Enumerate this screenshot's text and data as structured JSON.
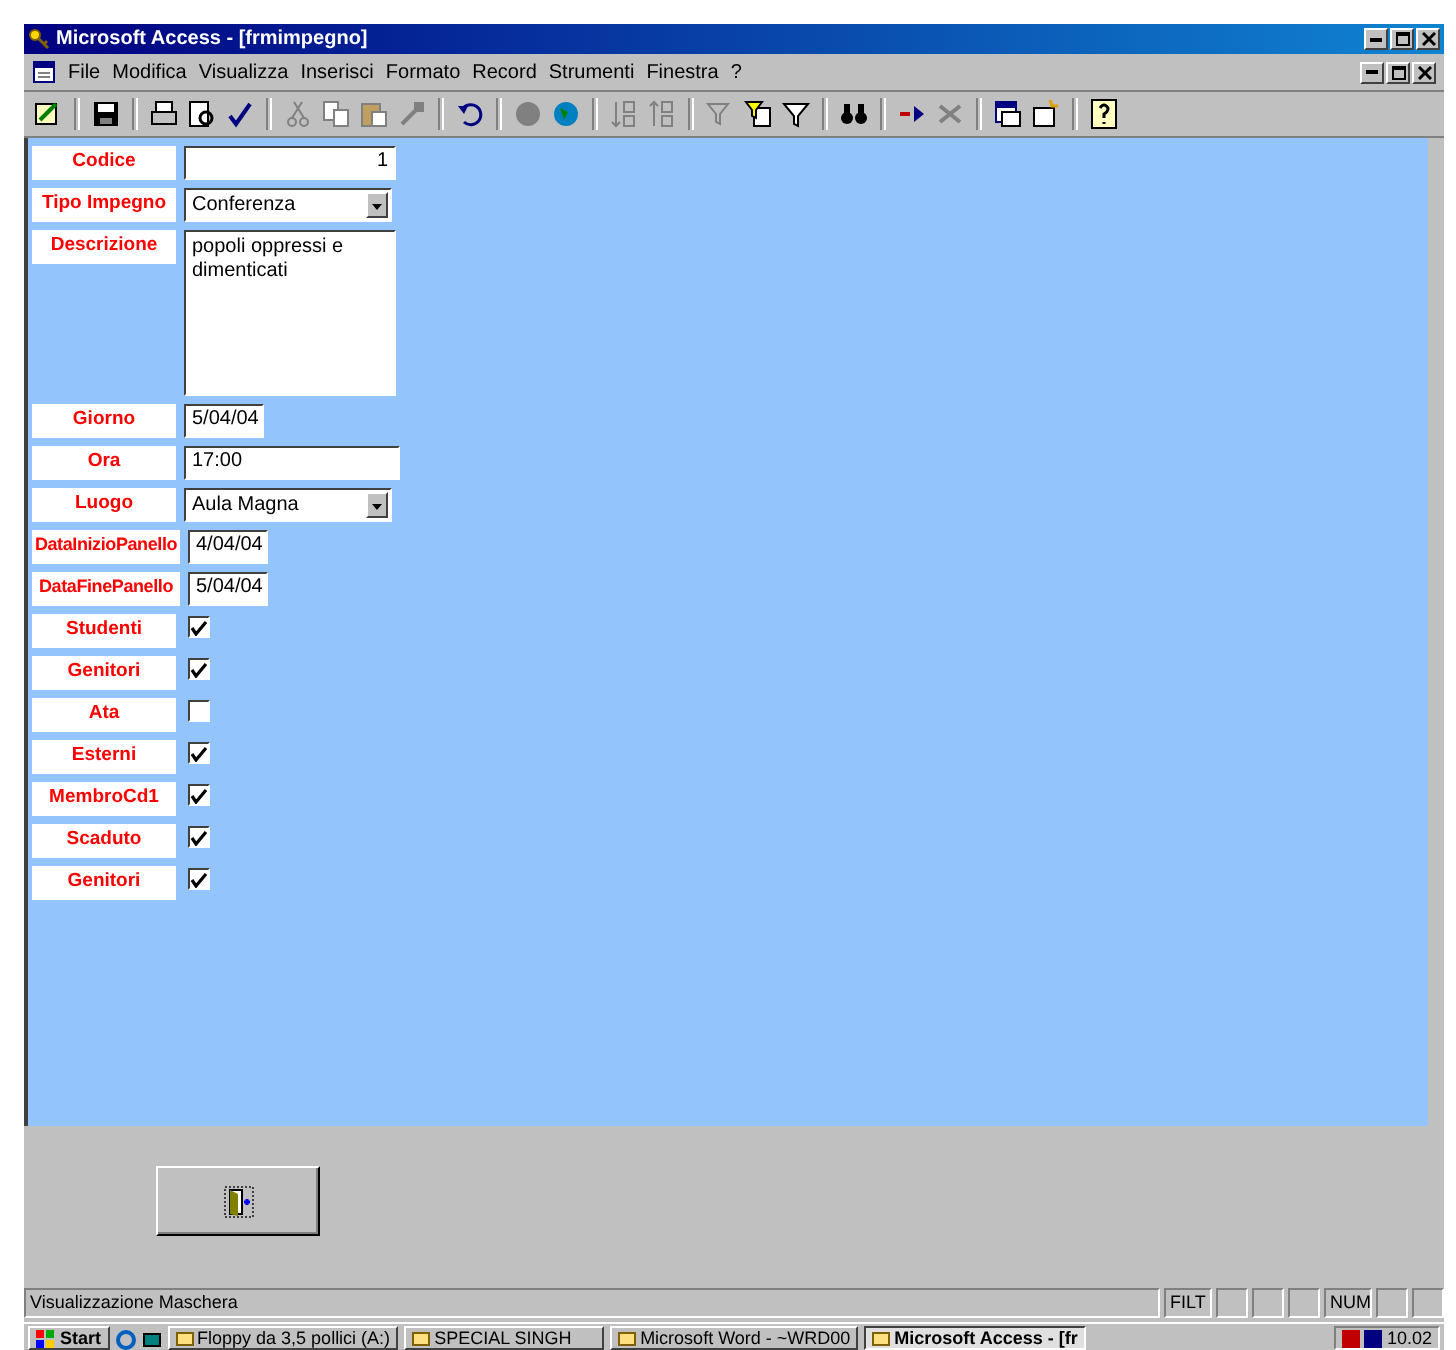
{
  "window": {
    "title": "Microsoft Access - [frmimpegno]"
  },
  "menu": [
    "File",
    "Modifica",
    "Visualizza",
    "Inserisci",
    "Formato",
    "Record",
    "Strumenti",
    "Finestra",
    "?"
  ],
  "form": {
    "fields": [
      {
        "label": "Codice",
        "kind": "number",
        "value": "1"
      },
      {
        "label": "Tipo Impegno",
        "kind": "combo",
        "value": "Conferenza"
      },
      {
        "label": "Descrizione",
        "kind": "memo",
        "value": "popoli oppressi e dimenticati"
      },
      {
        "label": "Giorno",
        "kind": "date",
        "value": "5/04/04"
      },
      {
        "label": "Ora",
        "kind": "text",
        "value": "17:00"
      },
      {
        "label": "Luogo",
        "kind": "combo",
        "value": "Aula Magna"
      },
      {
        "label": "DataInizioPanello",
        "kind": "date",
        "value": "4/04/04"
      },
      {
        "label": "DataFinePanello",
        "kind": "date",
        "value": "5/04/04"
      },
      {
        "label": "Studenti",
        "kind": "check",
        "checked": true
      },
      {
        "label": "Genitori",
        "kind": "check",
        "checked": true
      },
      {
        "label": "Ata",
        "kind": "check",
        "checked": false
      },
      {
        "label": "Esterni",
        "kind": "check",
        "checked": true
      },
      {
        "label": "MembroCd1",
        "kind": "check",
        "checked": true
      },
      {
        "label": "Scaduto",
        "kind": "check",
        "checked": true
      },
      {
        "label": "Genitori",
        "kind": "check",
        "checked": true
      }
    ]
  },
  "status_bar": {
    "message": "Visualizzazione Maschera",
    "indicators": [
      "FILT",
      "NUM"
    ]
  },
  "taskbar": {
    "start": "Start",
    "tasks": [
      {
        "label": "Floppy da 3,5 pollici (A:)",
        "selected": false
      },
      {
        "label": "SPECIAL SINGH",
        "selected": false
      },
      {
        "label": "Microsoft Word - ~WRD00",
        "selected": false
      },
      {
        "label": "Microsoft Access - [fr",
        "selected": true
      }
    ],
    "clock": "10.02"
  }
}
